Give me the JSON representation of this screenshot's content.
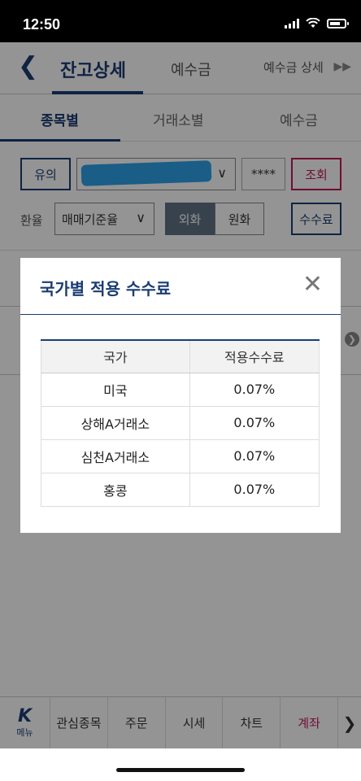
{
  "status_bar": {
    "time": "12:50"
  },
  "top_tabs": [
    {
      "label": "잔고상세",
      "active": true
    },
    {
      "label": "예수금",
      "active": false
    },
    {
      "label": "예수금 상세",
      "active": false
    }
  ],
  "sub_tabs": [
    {
      "label": "종목별",
      "active": true
    },
    {
      "label": "거래소별",
      "active": false
    },
    {
      "label": "예수금",
      "active": false
    }
  ],
  "controls": {
    "notice_button": "유의",
    "password_mask": "****",
    "search_button": "조회",
    "exchange_rate_label": "환율",
    "exchange_rate_select": "매매기준율",
    "currency_foreign": "외화",
    "currency_krw": "원화",
    "fee_button": "수수료"
  },
  "modal": {
    "title": "국가별 적용 수수료",
    "columns": [
      "국가",
      "적용수수료"
    ],
    "rows": [
      {
        "country": "미국",
        "fee": "0.07%"
      },
      {
        "country": "상해A거래소",
        "fee": "0.07%"
      },
      {
        "country": "심천A거래소",
        "fee": "0.07%"
      },
      {
        "country": "홍콩",
        "fee": "0.07%"
      }
    ]
  },
  "bottom_nav": {
    "menu_label": "메뉴",
    "items": [
      "관심종목",
      "주문",
      "시세",
      "차트",
      "계좌"
    ]
  },
  "colors": {
    "accent": "#1a3d72",
    "highlight": "#c2185b"
  }
}
